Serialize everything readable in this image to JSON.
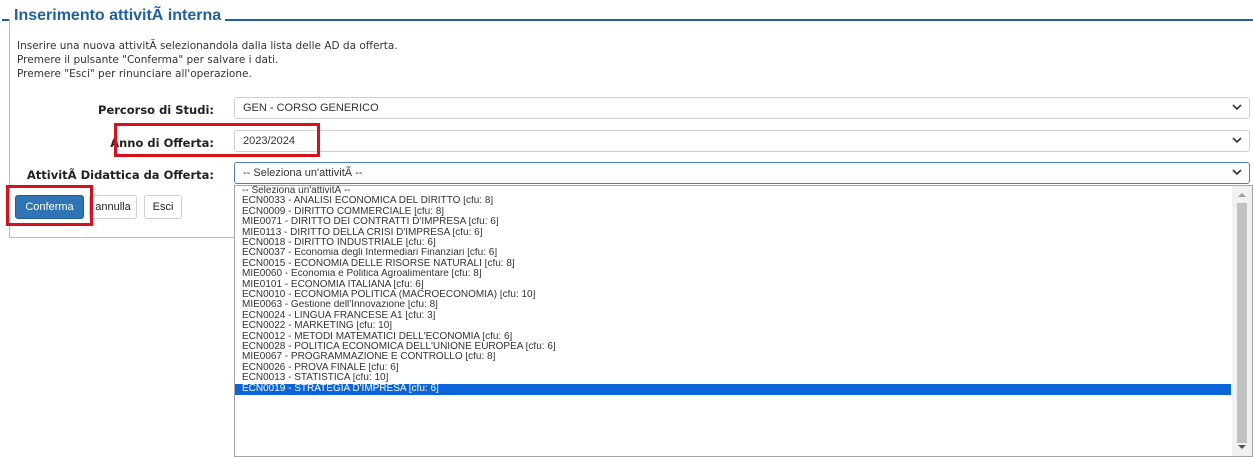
{
  "form": {
    "legend": "Inserimento attivitÃ  interna",
    "intro_lines": [
      "Inserire una nuova attivitÃ  selezionandola dalla lista delle AD da offerta.",
      "Premere il pulsante \"Conferma\" per salvare i dati.",
      "Premere \"Esci\" per rinunciare all'operazione."
    ],
    "fields": {
      "percorso": {
        "label": "Percorso di Studi:",
        "value": "GEN - CORSO GENERICO"
      },
      "anno": {
        "label": "Anno di Offerta:",
        "value": "2023/2024"
      },
      "attivita": {
        "label": "AttivitÃ  Didattica da Offerta:",
        "value": "-- Seleziona un'attivitÃ  --"
      }
    },
    "buttons": {
      "conferma": "Conferma",
      "annulla": "annulla",
      "esci": "Esci"
    },
    "highlight_color": "#d6111c",
    "accent_color": "#1f5fa5"
  },
  "dropdown": {
    "selected_index": 21,
    "options": [
      "-- Seleziona un'attivitÃ  --",
      "ECN0033 - ANALISI ECONOMICA DEL DIRITTO [cfu: 8]",
      "ECN0009 - DIRITTO COMMERCIALE [cfu: 8]",
      "MIE0071 - DIRITTO DEI CONTRATTI D'IMPRESA [cfu: 6]",
      "MIE0113 - DIRITTO DELLA CRISI D'IMPRESA [cfu: 6]",
      "ECN0018 - DIRITTO INDUSTRIALE [cfu: 6]",
      "ECN0037 - Economia degli Intermediari Finanziari [cfu: 6]",
      "ECN0015 - ECONOMIA DELLE RISORSE NATURALI [cfu: 8]",
      "MIE0060 - Economia e Politica Agroalimentare [cfu: 8]",
      "MIE0101 - ECONOMIA ITALIANA [cfu: 6]",
      "ECN0010 - ECONOMIA POLITICA (MACROECONOMIA) [cfu: 10]",
      "MIE0063 - Gestione dell'Innovazione [cfu: 8]",
      "ECN0024 - LINGUA FRANCESE A1 [cfu: 3]",
      "ECN0022 - MARKETING [cfu: 10]",
      "ECN0012 - METODI MATEMATICI DELL'ECONOMIA [cfu: 6]",
      "ECN0028 - POLITICA ECONOMICA DELL'UNIONE EUROPEA [cfu: 6]",
      "MIE0067 - PROGRAMMAZIONE E CONTROLLO [cfu: 8]",
      "ECN0026 - PROVA FINALE [cfu: 6]",
      "ECN0013 - STATISTICA [cfu: 10]",
      "ECN0019 - STRATEGIA D'IMPRESA [cfu: 6]"
    ]
  }
}
